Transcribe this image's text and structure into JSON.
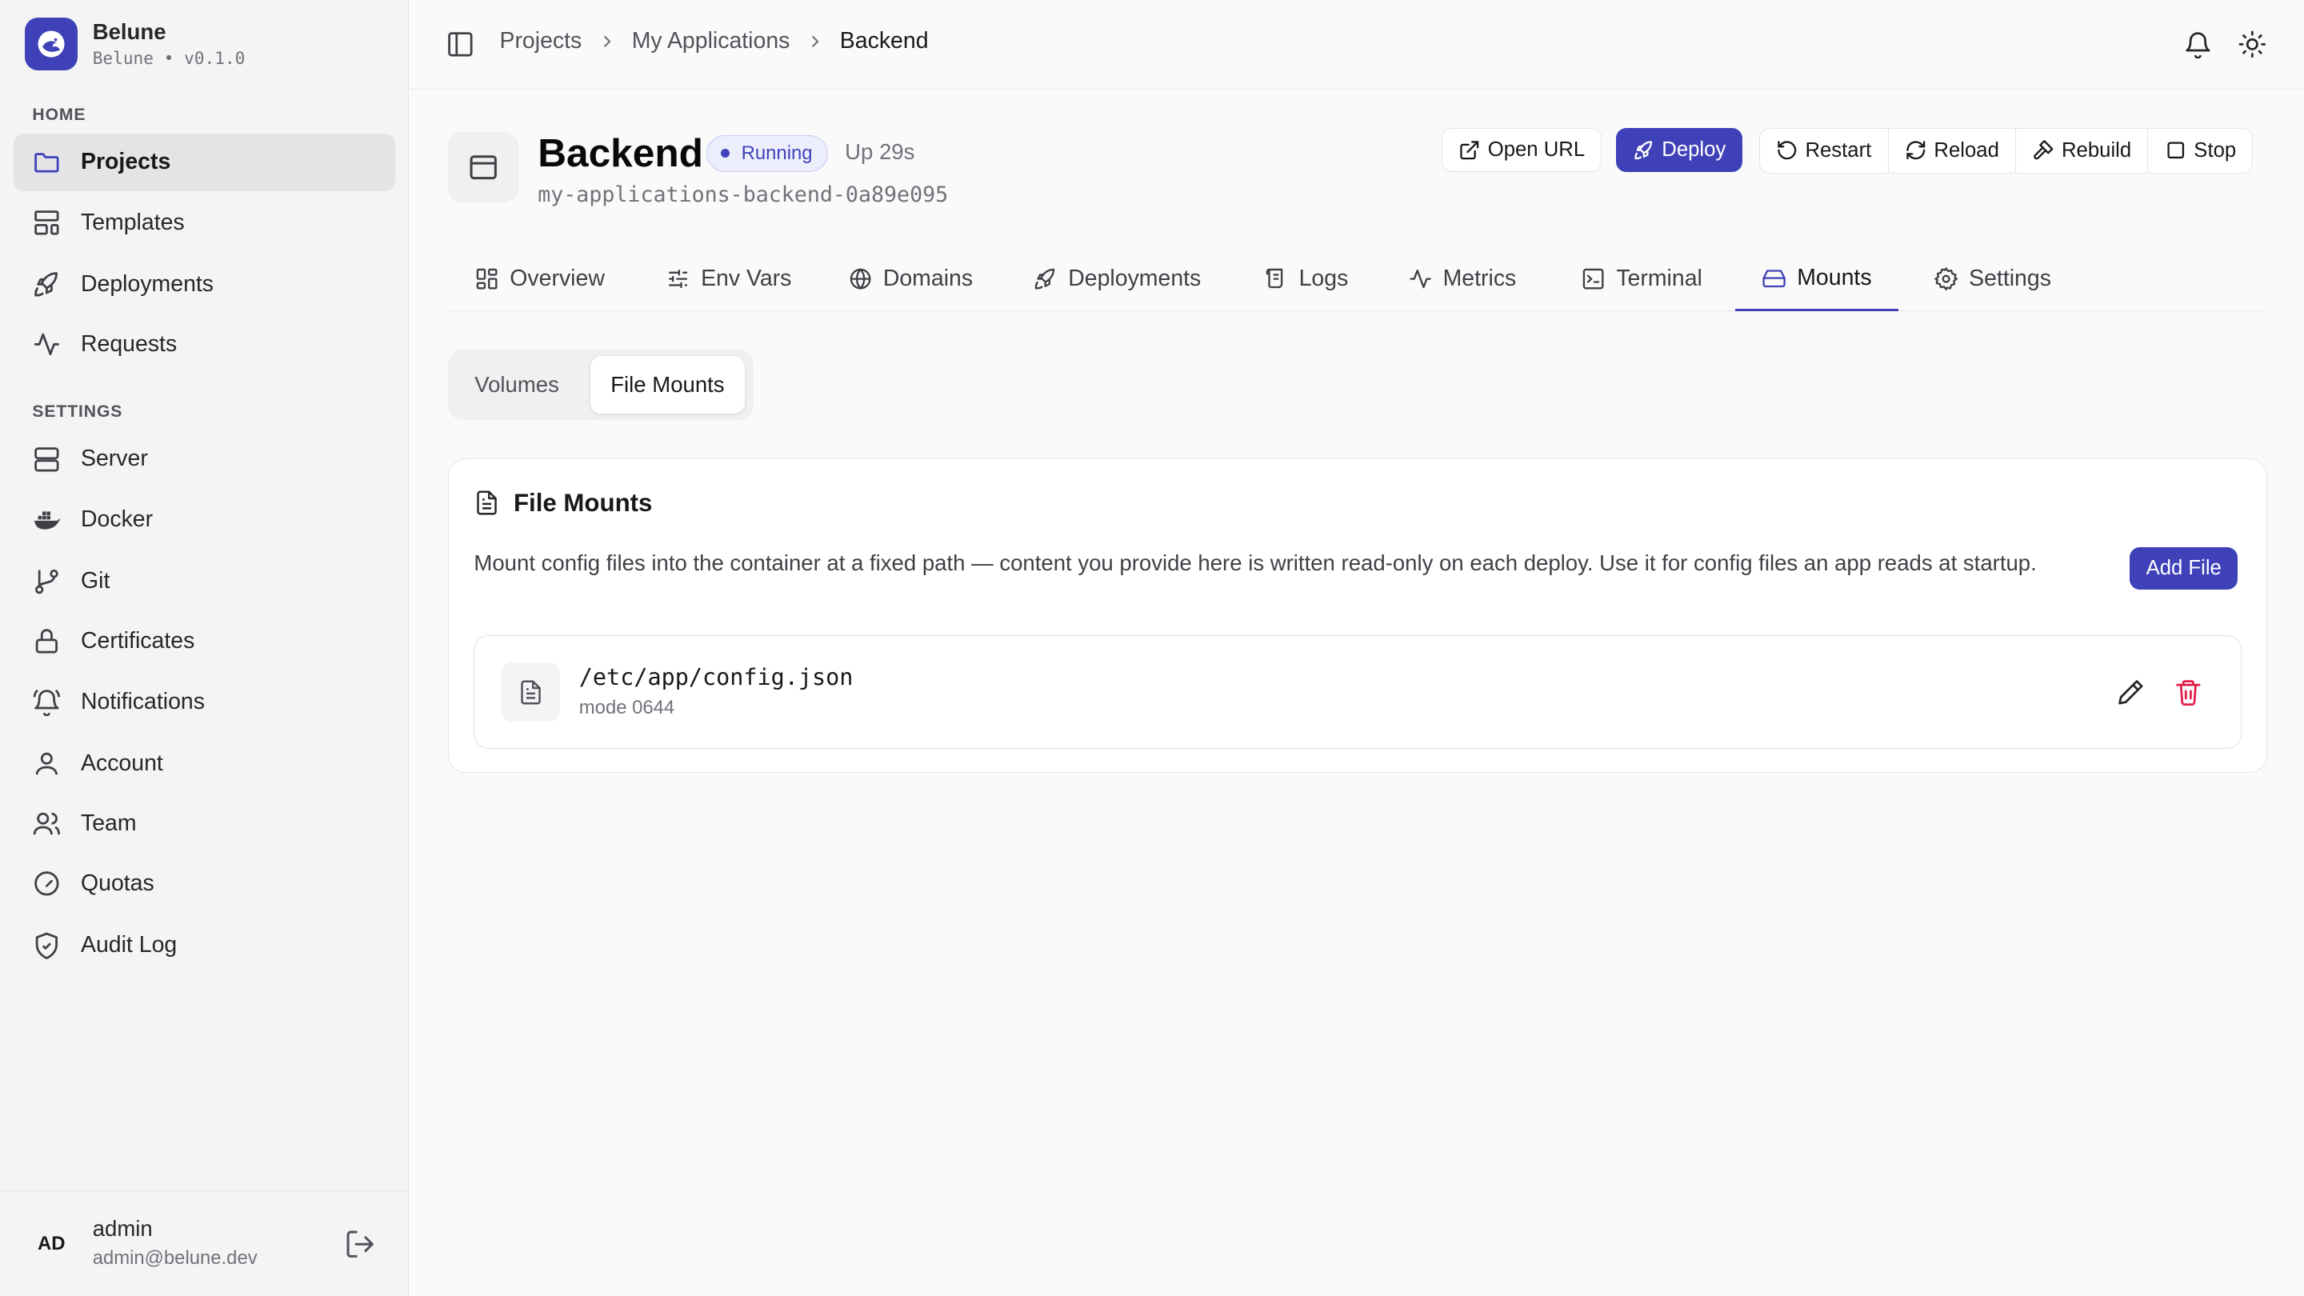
{
  "brand": {
    "name": "Belune",
    "subtitle": "Belune • v0.1.0"
  },
  "sidebar": {
    "home_label": "HOME",
    "home_items": [
      {
        "label": "Projects",
        "icon": "folder-icon",
        "active": true
      },
      {
        "label": "Templates",
        "icon": "layout-template-icon"
      },
      {
        "label": "Deployments",
        "icon": "rocket-icon"
      },
      {
        "label": "Requests",
        "icon": "activity-icon"
      }
    ],
    "settings_label": "SETTINGS",
    "settings_items": [
      {
        "label": "Server",
        "icon": "server-icon"
      },
      {
        "label": "Docker",
        "icon": "docker-icon"
      },
      {
        "label": "Git",
        "icon": "git-branch-icon"
      },
      {
        "label": "Certificates",
        "icon": "lock-icon"
      },
      {
        "label": "Notifications",
        "icon": "bell-ring-icon"
      },
      {
        "label": "Account",
        "icon": "user-icon"
      },
      {
        "label": "Team",
        "icon": "users-icon"
      },
      {
        "label": "Quotas",
        "icon": "gauge-icon"
      },
      {
        "label": "Audit Log",
        "icon": "shield-check-icon"
      }
    ]
  },
  "user": {
    "initials": "AD",
    "name": "admin",
    "email": "admin@belune.dev"
  },
  "breadcrumb": [
    "Projects",
    "My Applications",
    "Backend"
  ],
  "app": {
    "title": "Backend",
    "status": "Running",
    "uptime": "Up 29s",
    "container": "my-applications-backend-0a89e095"
  },
  "actions": {
    "open_url": "Open URL",
    "deploy": "Deploy",
    "restart": "Restart",
    "reload": "Reload",
    "rebuild": "Rebuild",
    "stop": "Stop"
  },
  "tabs": [
    {
      "label": "Overview",
      "icon": "layout-dashboard-icon"
    },
    {
      "label": "Env Vars",
      "icon": "sliders-icon"
    },
    {
      "label": "Domains",
      "icon": "globe-icon"
    },
    {
      "label": "Deployments",
      "icon": "rocket-icon"
    },
    {
      "label": "Logs",
      "icon": "scroll-icon"
    },
    {
      "label": "Metrics",
      "icon": "activity-icon"
    },
    {
      "label": "Terminal",
      "icon": "terminal-icon"
    },
    {
      "label": "Mounts",
      "icon": "hard-drive-icon",
      "active": true
    },
    {
      "label": "Settings",
      "icon": "gear-icon"
    }
  ],
  "subtabs": {
    "volumes": "Volumes",
    "file_mounts": "File Mounts",
    "active": "File Mounts"
  },
  "file_mounts": {
    "title": "File Mounts",
    "description": "Mount config files into the container at a fixed path — content you provide here is written read-only on each deploy. Use it for config files an app reads at startup.",
    "add_button": "Add File",
    "items": [
      {
        "path": "/etc/app/config.json",
        "mode": "mode 0644"
      }
    ]
  },
  "colors": {
    "accent": "#3f41b8",
    "danger": "#e11d48",
    "sidebar_bg": "#f4f4f5"
  }
}
